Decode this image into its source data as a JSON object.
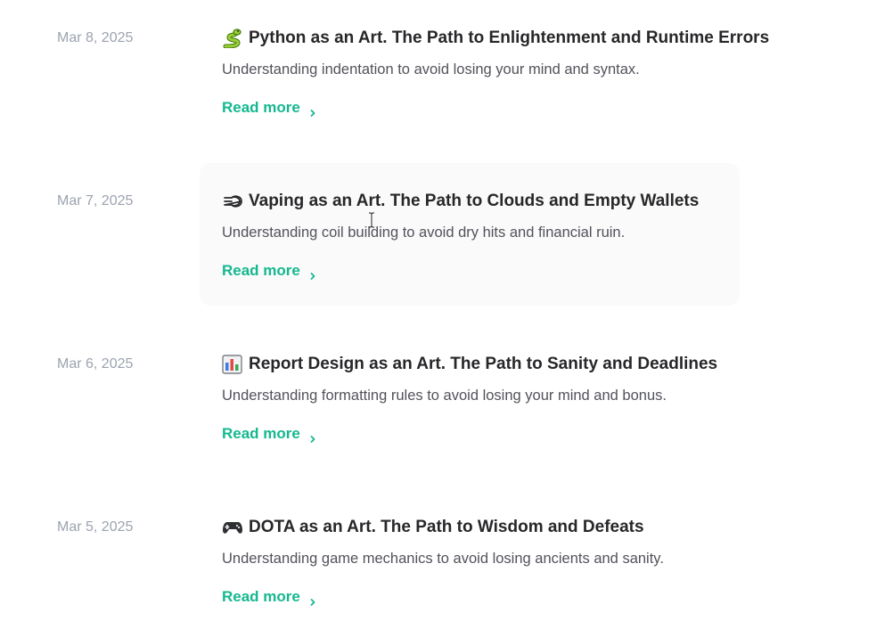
{
  "posts": [
    {
      "date": "Mar 8, 2025",
      "icon": "snake-icon",
      "title": "Python as an Art. The Path to Enlightenment and Runtime Errors",
      "description": "Understanding indentation to avoid losing your mind and syntax.",
      "read_more": "Read more"
    },
    {
      "date": "Mar 7, 2025",
      "icon": "dashing-away-icon",
      "title": "Vaping as an Art. The Path to Clouds and Empty Wallets",
      "description": "Understanding coil building to avoid dry hits and financial ruin.",
      "read_more": "Read more"
    },
    {
      "date": "Mar 6, 2025",
      "icon": "bar-chart-icon",
      "title": "Report Design as an Art. The Path to Sanity and Deadlines",
      "description": "Understanding formatting rules to avoid losing your mind and bonus.",
      "read_more": "Read more"
    },
    {
      "date": "Mar 5, 2025",
      "icon": "game-controller-icon",
      "title": "DOTA as an Art. The Path to Wisdom and Defeats",
      "description": "Understanding game mechanics to avoid losing ancients and sanity.",
      "read_more": "Read more"
    }
  ],
  "colors": {
    "accent": "#14b88f",
    "date": "#9ca3af",
    "title": "#27272a",
    "description": "#52525b",
    "hover_background": "#fafafa"
  }
}
